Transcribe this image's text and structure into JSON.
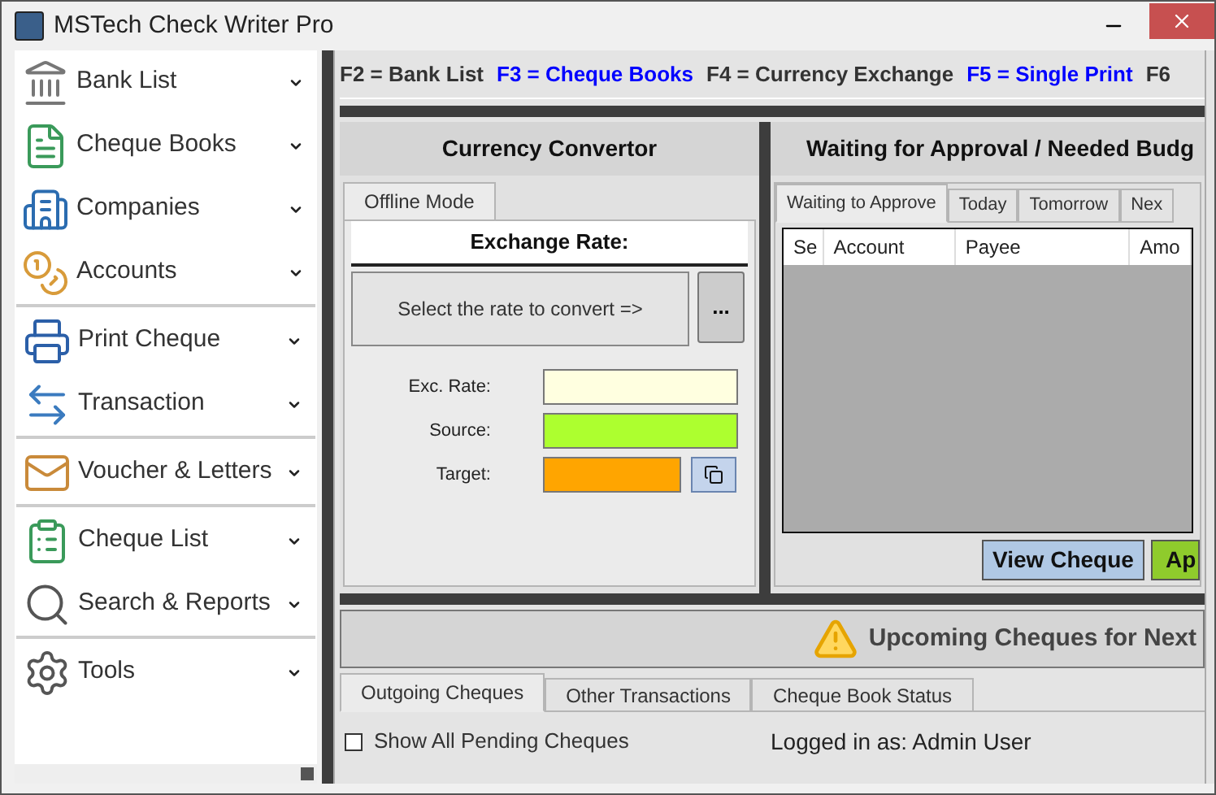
{
  "window": {
    "title": "MSTech Check Writer Pro"
  },
  "sidebar": {
    "groups": [
      {
        "items": [
          {
            "label": "Bank List"
          },
          {
            "label": "Cheque Books"
          },
          {
            "label": "Companies"
          },
          {
            "label": "Accounts"
          }
        ]
      },
      {
        "items": [
          {
            "label": "Print Cheque"
          },
          {
            "label": "Transaction"
          }
        ]
      },
      {
        "items": [
          {
            "label": "Voucher & Letters"
          }
        ]
      },
      {
        "items": [
          {
            "label": "Cheque List"
          },
          {
            "label": "Search & Reports"
          }
        ]
      },
      {
        "items": [
          {
            "label": "Tools"
          }
        ]
      }
    ]
  },
  "shortcuts": [
    {
      "label": "F2 = Bank List",
      "color": "#333333"
    },
    {
      "label": "F3 = Cheque Books",
      "color": "#0000ff"
    },
    {
      "label": "F4 = Currency Exchange",
      "color": "#333333"
    },
    {
      "label": "F5 = Single Print",
      "color": "#0000ff"
    },
    {
      "label": "F6",
      "color": "#333333"
    }
  ],
  "converter": {
    "title": "Currency Convertor",
    "tabs": [
      {
        "label": "Offline Mode",
        "selected": true
      }
    ],
    "heading": "Exchange Rate:",
    "select_button": "Select the rate to convert =>",
    "more_button": "...",
    "fields": [
      {
        "label": "Exc. Rate:",
        "color": "#ffffe0"
      },
      {
        "label": "Source:",
        "color": "#adff2f"
      },
      {
        "label": "Target:",
        "color": "#ffa500"
      }
    ]
  },
  "approval": {
    "title": "Waiting for Approval / Needed Budg",
    "tabs": [
      {
        "label": "Waiting to Approve",
        "selected": true
      },
      {
        "label": "Today",
        "selected": false
      },
      {
        "label": "Tomorrow",
        "selected": false
      },
      {
        "label": "Nex",
        "selected": false
      }
    ],
    "table": {
      "columns": [
        "Se",
        "Account",
        "Payee",
        "Amo"
      ]
    },
    "buttons": [
      {
        "label": "View Cheque",
        "color": "#b0c8e4"
      },
      {
        "label": "Ap",
        "color": "#8fcb2c"
      }
    ]
  },
  "upcoming": {
    "title": "Upcoming Cheques for Next"
  },
  "bottom_tabs": [
    {
      "label": "Outgoing Cheques",
      "selected": true
    },
    {
      "label": "Other Transactions",
      "selected": false
    },
    {
      "label": "Cheque Book Status",
      "selected": false
    }
  ],
  "show_all_pending": {
    "label": "Show All Pending Cheques",
    "checked": false
  },
  "status": "Logged in as: Admin User"
}
